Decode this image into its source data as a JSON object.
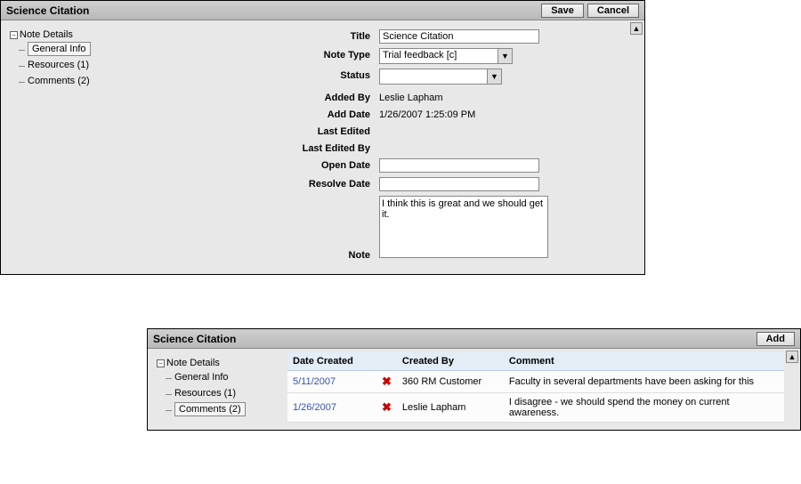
{
  "window1": {
    "title": "Science Citation",
    "save_label": "Save",
    "cancel_label": "Cancel"
  },
  "tree": {
    "root_label": "Note Details",
    "item_general": "General Info",
    "item_resources": "Resources (1)",
    "item_comments": "Comments (2)"
  },
  "form": {
    "labels": {
      "title": "Title",
      "note_type": "Note Type",
      "status": "Status",
      "added_by": "Added By",
      "add_date": "Add Date",
      "last_edited": "Last Edited",
      "last_edited_by": "Last Edited By",
      "open_date": "Open Date",
      "resolve_date": "Resolve Date",
      "note": "Note"
    },
    "values": {
      "title": "Science Citation",
      "note_type": "Trial feedback [c]",
      "status": "",
      "added_by": "Leslie Lapham",
      "add_date": "1/26/2007 1:25:09 PM",
      "last_edited": "",
      "last_edited_by": "",
      "open_date": "",
      "resolve_date": "",
      "note": "I think this is great and we should get it."
    }
  },
  "window2": {
    "title": "Science Citation",
    "add_label": "Add"
  },
  "comments": {
    "headers": {
      "date": "Date Created",
      "by": "Created By",
      "comment": "Comment"
    },
    "rows": [
      {
        "date": "5/11/2007",
        "by": "360 RM Customer",
        "comment": "Faculty in several departments have been asking for this"
      },
      {
        "date": "1/26/2007",
        "by": "Leslie Lapham",
        "comment": "I disagree - we should spend the money on current awareness."
      }
    ]
  }
}
